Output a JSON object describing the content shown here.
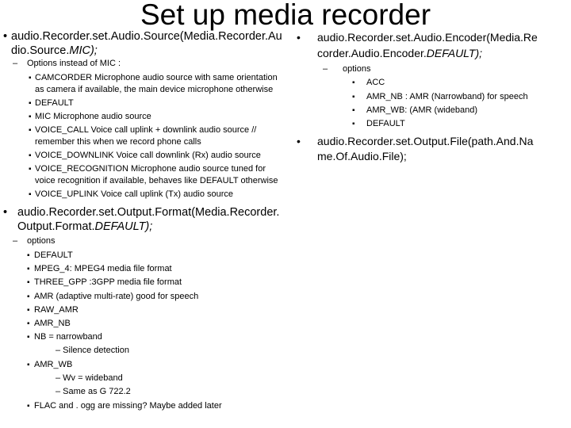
{
  "title": "Set up media recorder",
  "left": {
    "source": {
      "line1": "audio.Recorder.set.Audio.Source(Media.Recorder.Au",
      "line2_a": "dio.Source.",
      "line2_b": "MIC);",
      "heading": "Options instead of MIC :",
      "items": [
        "CAMCORDER Microphone audio source with same orientation",
        "as camera if available, the main device microphone otherwise",
        "DEFAULT",
        "MIC Microphone audio source",
        "VOICE_CALL Voice call uplink + downlink audio source //",
        "remember this when we record phone calls",
        "VOICE_DOWNLINK Voice call downlink (Rx) audio source",
        "VOICE_RECOGNITION Microphone audio source tuned for",
        "voice recognition if available, behaves like DEFAULT otherwise",
        "VOICE_UPLINK Voice call uplink (Tx) audio source"
      ]
    },
    "format": {
      "line1": "audio.Recorder.set.Output.Format(Media.Recorder.",
      "line2_a": "Output.Format.",
      "line2_b": "DEFAULT);",
      "heading": "options",
      "items": [
        "DEFAULT",
        "MPEG_4: MPEG4 media file format",
        "THREE_GPP :3GPP media file format",
        "AMR (adaptive multi-rate)  good for speech",
        "RAW_AMR",
        "AMR_NB",
        "NB = narrowband",
        "– Silence detection",
        "AMR_WB",
        "– Wv = wideband",
        "– Same as G 722.2",
        "FLAC and . ogg are missing? Maybe added later"
      ]
    }
  },
  "right": {
    "encoder": {
      "line1": "audio.Recorder.set.Audio.Encoder(Media.Re",
      "line2_a": "corder.Audio.Encoder.",
      "line2_b": "DEFAULT);",
      "heading": "options",
      "items": [
        "ACC",
        "AMR_NB : AMR (Narrowband) for speech",
        "AMR_WB: (AMR (wideband)",
        "DEFAULT"
      ]
    },
    "output_file": {
      "line1": "audio.Recorder.set.Output.File(path.And.Na",
      "line2": "me.Of.Audio.File);"
    }
  },
  "bullet": "•",
  "dash": "–",
  "sub_bullet": "▪"
}
